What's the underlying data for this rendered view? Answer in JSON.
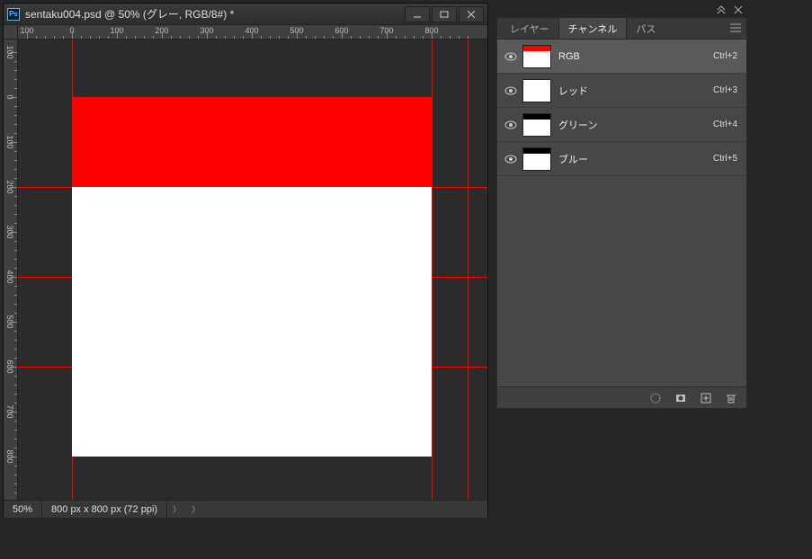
{
  "document": {
    "title": "sentaku004.psd @ 50% (グレー, RGB/8#) *",
    "zoom": "50%",
    "dimensions": "800 px x 800 px (72 ppi)"
  },
  "ruler_top": [
    "100",
    "0",
    "100",
    "200",
    "300",
    "400",
    "500",
    "600",
    "700",
    "800"
  ],
  "ruler_left": [
    "100",
    "0",
    "100",
    "200",
    "300",
    "400",
    "500",
    "600",
    "700",
    "800"
  ],
  "panel": {
    "tabs": {
      "layers": "レイヤー",
      "channels": "チャンネル",
      "paths": "パス"
    },
    "channels": [
      {
        "name": "RGB",
        "shortcut": "Ctrl+2",
        "thumb_top": "#ff0000",
        "selected": true
      },
      {
        "name": "レッド",
        "shortcut": "Ctrl+3",
        "thumb_top": "#ffffff",
        "selected": false
      },
      {
        "name": "グリーン",
        "shortcut": "Ctrl+4",
        "thumb_top": "#000000",
        "selected": false
      },
      {
        "name": "ブルー",
        "shortcut": "Ctrl+5",
        "thumb_top": "#000000",
        "selected": false
      }
    ]
  }
}
